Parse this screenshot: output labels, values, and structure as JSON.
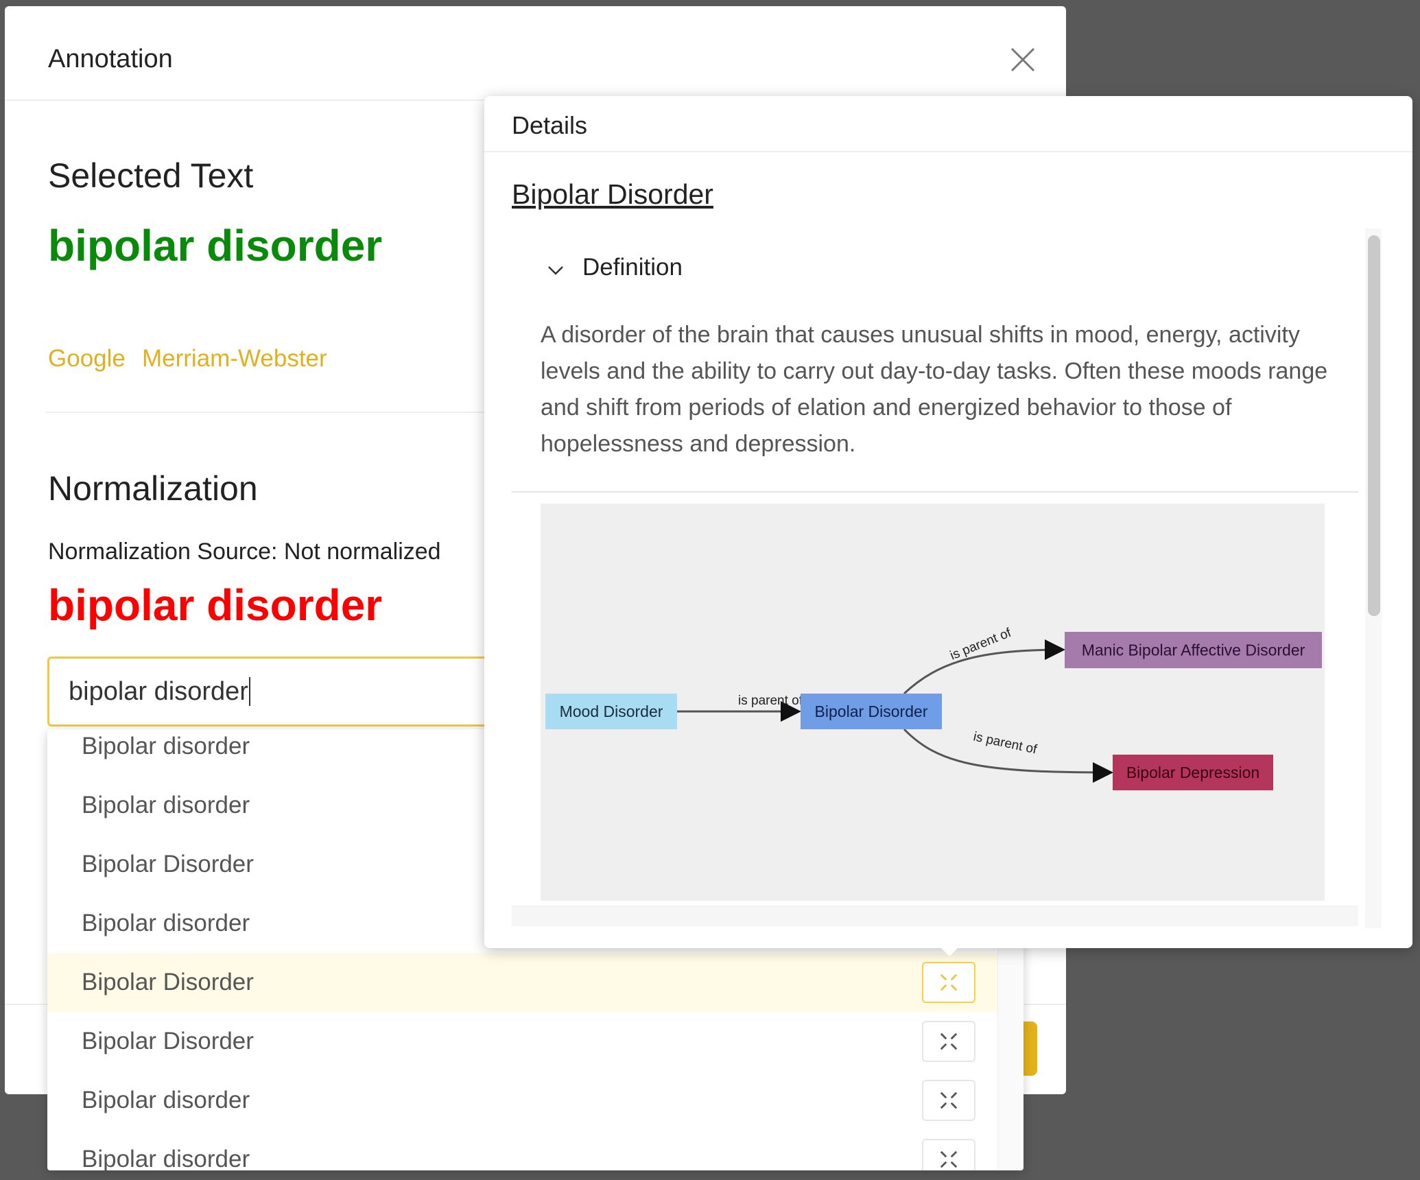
{
  "modal": {
    "title": "Annotation",
    "close_icon": "close-icon"
  },
  "selected": {
    "heading": "Selected Text",
    "value": "bipolar disorder",
    "value_color": "#0a8a0a",
    "links": [
      "Google",
      "Merriam-Webster"
    ],
    "link_color": "#e0b020"
  },
  "normalization": {
    "heading": "Normalization",
    "source_label": "Normalization Source: Not normalized",
    "value": "bipolar disorder",
    "value_color": "#ff0000",
    "input_value": "bipolar disorder"
  },
  "dropdown": {
    "items": [
      "Bipolar disorder",
      "Bipolar disorder",
      "Bipolar Disorder",
      "Bipolar disorder",
      "Bipolar Disorder",
      "Bipolar Disorder",
      "Bipolar disorder",
      "Bipolar disorder"
    ],
    "highlighted_index": 4
  },
  "details": {
    "title": "Details",
    "term": "Bipolar Disorder",
    "section": "Definition",
    "definition": "A disorder of the brain that causes unusual shifts in mood, energy, activity levels and the ability to carry out day-to-day tasks. Often these moods range and shift from periods of elation and energized behavior to those of hopelessness and depression.",
    "graph": {
      "nodes": [
        {
          "label": "Mood Disorder",
          "color": "#a8dcf2"
        },
        {
          "label": "Bipolar Disorder",
          "color": "#6f9de6"
        },
        {
          "label": "Manic Bipolar Affective Disorder",
          "color": "#a57bac"
        },
        {
          "label": "Bipolar Depression",
          "color": "#b5365d"
        }
      ],
      "edges": [
        {
          "from": 0,
          "to": 1,
          "label": "is parent of"
        },
        {
          "from": 1,
          "to": 2,
          "label": "is parent of"
        },
        {
          "from": 1,
          "to": 3,
          "label": "is parent of"
        }
      ]
    }
  }
}
